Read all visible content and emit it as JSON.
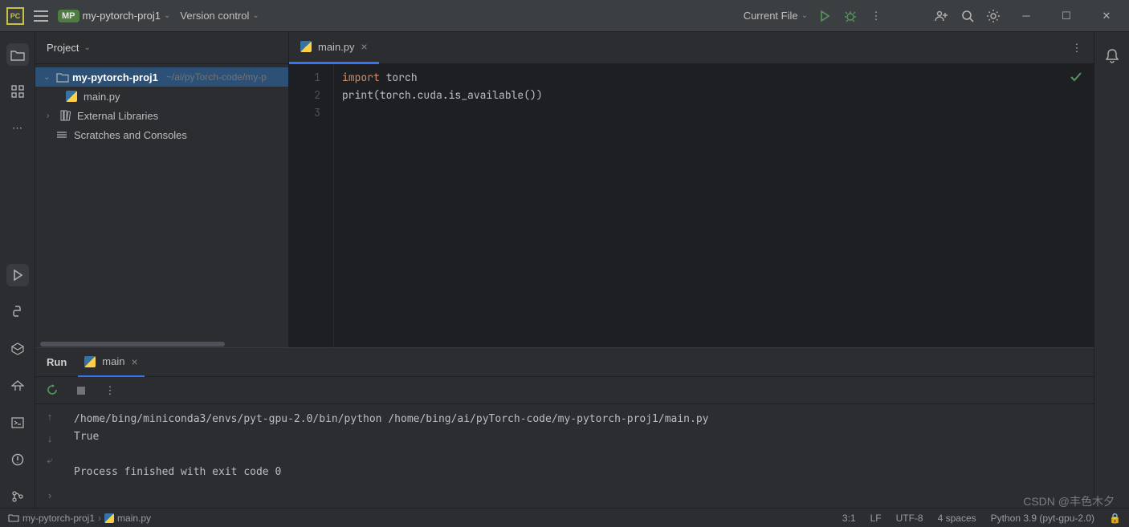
{
  "titlebar": {
    "project_badge": "MP",
    "project_name": "my-pytorch-proj1",
    "version_control": "Version control",
    "current_file": "Current File"
  },
  "panel": {
    "title": "Project",
    "root_name": "my-pytorch-proj1",
    "root_path": "~/ai/pyTorch-code/my-p",
    "file1": "main.py",
    "external": "External Libraries",
    "scratches": "Scratches and Consoles"
  },
  "editor": {
    "tab_name": "main.py",
    "lines": {
      "l1": "1",
      "l2": "2",
      "l3": "3"
    },
    "code": {
      "kw_import": "import",
      "mod": " torch",
      "fn_print": "print",
      "expr": "(torch.cuda.is_available())"
    }
  },
  "run": {
    "title": "Run",
    "tab": "main",
    "output_cmd": "/home/bing/miniconda3/envs/pyt-gpu-2.0/bin/python /home/bing/ai/pyTorch-code/my-pytorch-proj1/main.py",
    "output_result": "True",
    "output_exit": "Process finished with exit code 0"
  },
  "status": {
    "crumb1": "my-pytorch-proj1",
    "crumb2": "main.py",
    "pos": "3:1",
    "lf": "LF",
    "enc": "UTF-8",
    "indent": "4 spaces",
    "interp": "Python 3.9 (pyt-gpu-2.0)"
  },
  "watermark": "CSDN @丰色木夕"
}
